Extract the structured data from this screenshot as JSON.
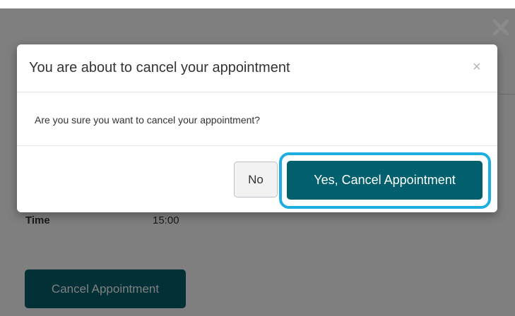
{
  "page": {
    "time_label": "Time",
    "time_value": "15:00",
    "cancel_button_label": "Cancel Appointment"
  },
  "modal": {
    "title": "You are about to cancel your appointment",
    "close_symbol": "×",
    "question": "Are you sure you want to cancel your appointment?",
    "no_label": "No",
    "yes_label": "Yes, Cancel Appointment"
  },
  "icons": {
    "page_close": "close-icon",
    "modal_close": "close-icon"
  },
  "colors": {
    "primary_button": "#02606e",
    "highlight_ring": "#1eaee0",
    "backdrop": "rgba(0,0,0,0.5)"
  }
}
